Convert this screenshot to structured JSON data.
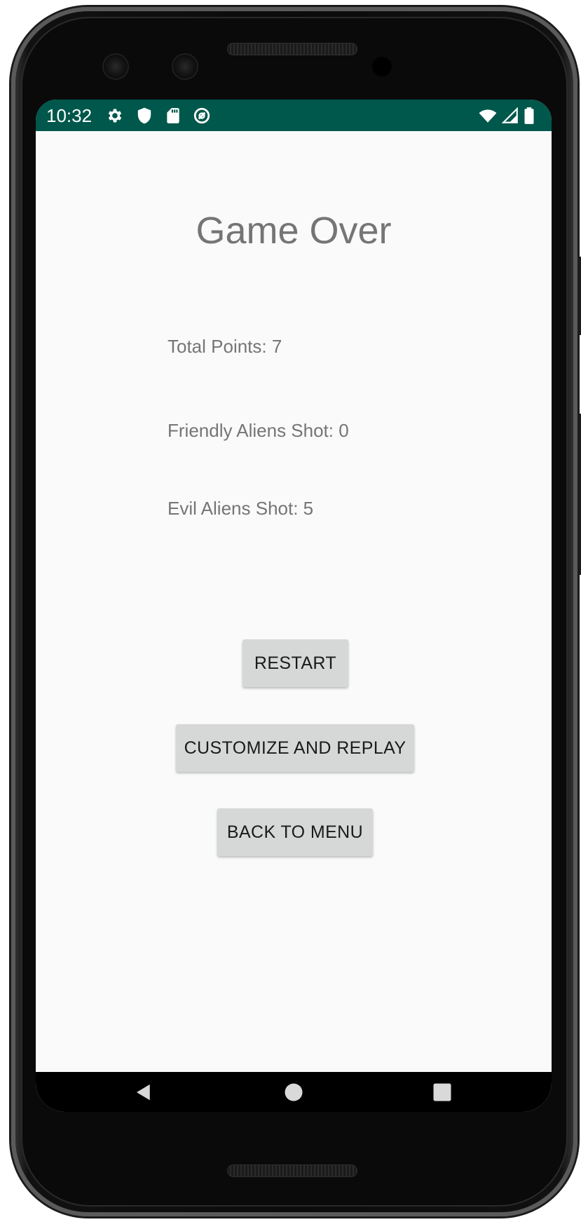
{
  "status_bar": {
    "time": "10:32",
    "left_icons": [
      "settings-icon",
      "shield-icon",
      "sd-card-icon",
      "data-saver-icon"
    ],
    "right_icons": [
      "wifi-icon",
      "signal-icon",
      "battery-icon"
    ],
    "background_color": "#00574b"
  },
  "screen": {
    "title": "Game Over",
    "stats": {
      "total_points": "Total Points: 7",
      "friendly_aliens_shot": "Friendly Aliens Shot: 0",
      "evil_aliens_shot": "Evil Aliens Shot: 5"
    },
    "buttons": {
      "restart": "RESTART",
      "customize_and_replay": "CUSTOMIZE AND REPLAY",
      "back_to_menu": "BACK TO MENU"
    }
  },
  "nav_bar": {
    "icons": [
      "back-icon",
      "home-icon",
      "recents-icon"
    ]
  }
}
